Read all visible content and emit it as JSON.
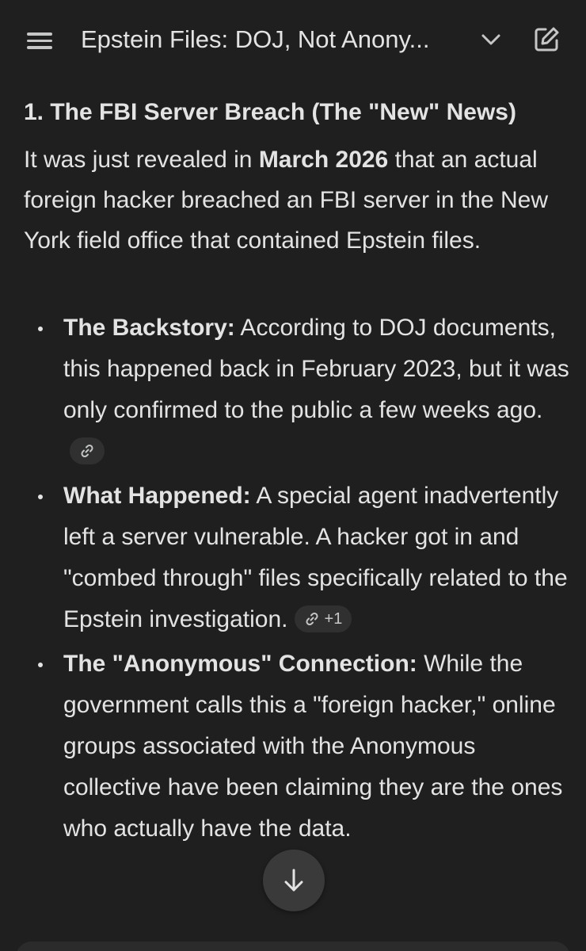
{
  "header": {
    "title": "Epstein Files: DOJ, Not Anony...",
    "menu_icon": "hamburger-menu-icon",
    "chevron_icon": "chevron-down-icon",
    "edit_icon": "new-chat-edit-icon"
  },
  "response": {
    "heading": "1. The FBI Server Breach (The \"New\" News)",
    "intro": {
      "before": "It was just revealed in ",
      "bold": "March 2026",
      "after": " that an actual foreign hacker breached an FBI server in the New York field office that contained Epstein files."
    },
    "bullets": [
      {
        "label": "The Backstory:",
        "text": " According to DOJ documents, this happened back in February 2023, but it was only confirmed to the public a few weeks ago.",
        "citation_extra": ""
      },
      {
        "label": "What Happened:",
        "text": " A special agent inadvertently left a server vulnerable. A hacker got in and \"combed through\" files specifically related to the Epstein investigation.",
        "citation_extra": "+1"
      },
      {
        "label": "The \"Anonymous\" Connection:",
        "text": " While the government calls this a \"foreign hacker,\" online groups associated with the Anonymous collective have been claiming they are the ones who actually have the data.",
        "citation_extra": null
      }
    ]
  },
  "scroll_button_icon": "arrow-down-icon",
  "colors": {
    "background": "#1f1f1f",
    "text": "#e3e3e3",
    "icon": "#c4c7c5",
    "chip": "#303030",
    "fab": "#3a3a3a"
  }
}
